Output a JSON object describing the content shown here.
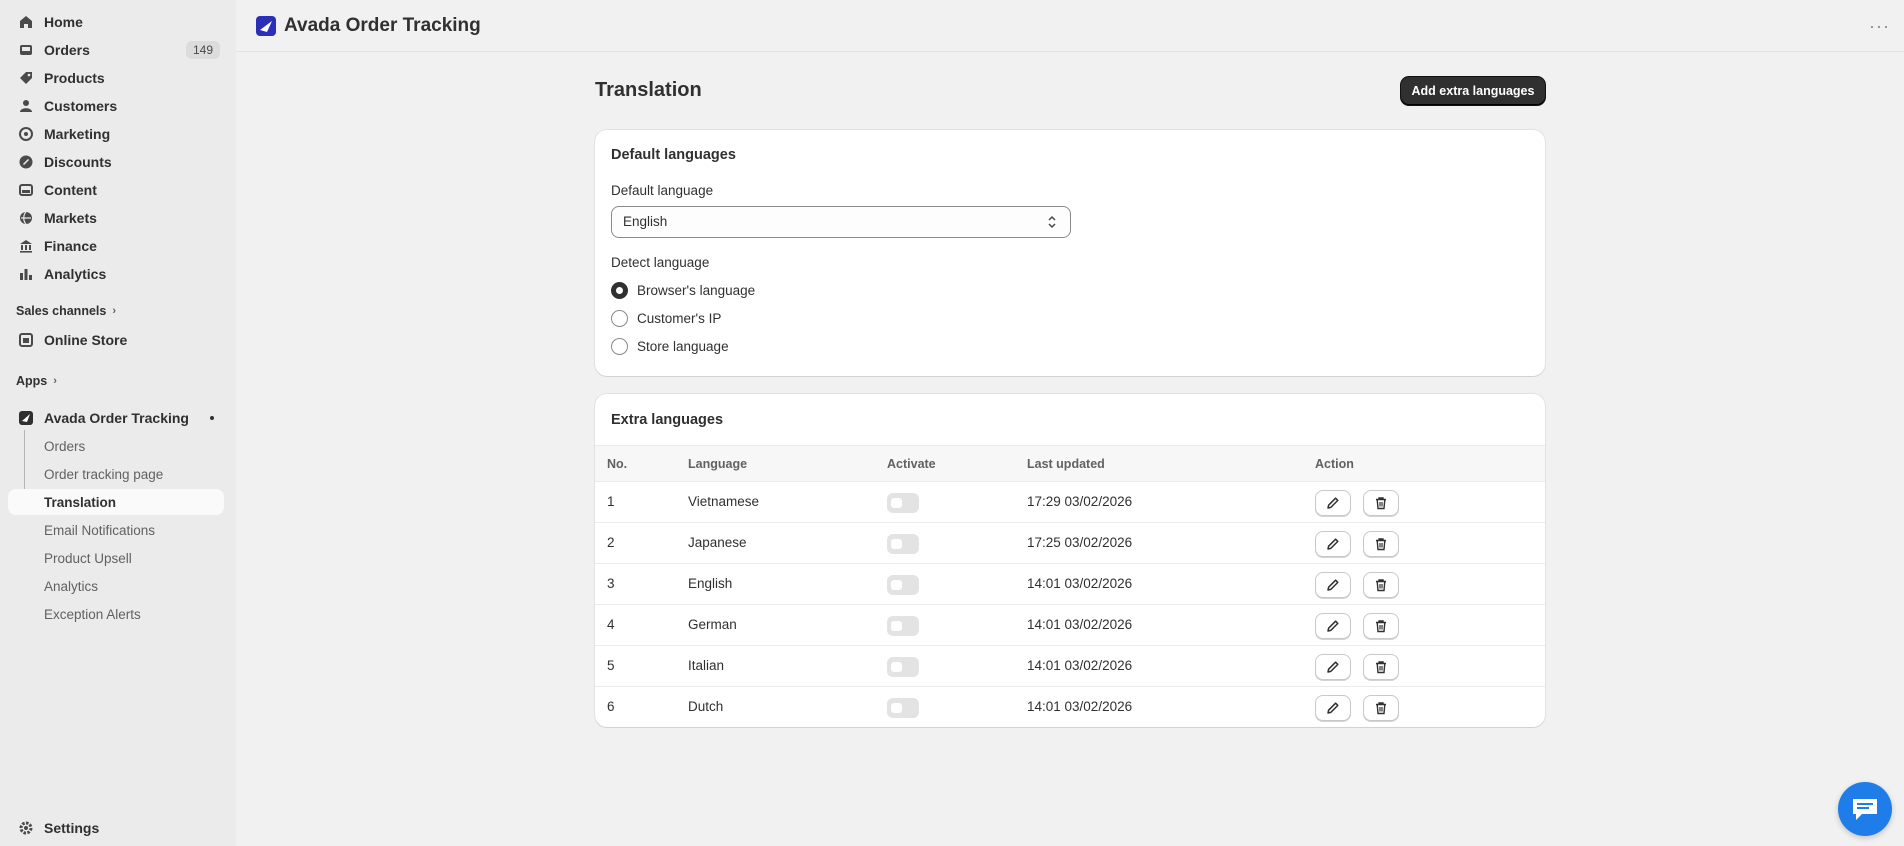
{
  "sidebar": {
    "main_items": [
      {
        "label": "Home",
        "icon": "home-icon"
      },
      {
        "label": "Orders",
        "icon": "inbox-icon",
        "count": "149"
      },
      {
        "label": "Products",
        "icon": "tag-icon"
      },
      {
        "label": "Customers",
        "icon": "person-icon"
      },
      {
        "label": "Marketing",
        "icon": "target-icon"
      },
      {
        "label": "Discounts",
        "icon": "discount-icon"
      },
      {
        "label": "Content",
        "icon": "content-icon"
      },
      {
        "label": "Markets",
        "icon": "globe-icon"
      },
      {
        "label": "Finance",
        "icon": "bank-icon"
      },
      {
        "label": "Analytics",
        "icon": "bar-chart-icon"
      }
    ],
    "sales_channels_label": "Sales channels",
    "online_store_label": "Online Store",
    "apps_label": "Apps",
    "app_name": "Avada Order Tracking",
    "app_sub_items": [
      "Orders",
      "Order tracking page",
      "Translation",
      "Email Notifications",
      "Product Upsell",
      "Analytics",
      "Exception Alerts"
    ],
    "settings_label": "Settings"
  },
  "topbar": {
    "app_title": "Avada Order Tracking",
    "more_label": "···"
  },
  "page": {
    "title": "Translation",
    "add_button_label": "Add extra languages"
  },
  "default_card": {
    "title": "Default languages",
    "default_language_label": "Default language",
    "default_language_value": "English",
    "detect_language_label": "Detect language",
    "detect_options": [
      {
        "label": "Browser's language",
        "selected": true
      },
      {
        "label": "Customer's IP",
        "selected": false
      },
      {
        "label": "Store language",
        "selected": false
      }
    ]
  },
  "extra_card": {
    "title": "Extra languages",
    "columns": [
      "No.",
      "Language",
      "Activate",
      "Last updated",
      "Action"
    ],
    "rows": [
      {
        "no": "1",
        "language": "Vietnamese",
        "active": false,
        "updated": "17:29 03/02/2026"
      },
      {
        "no": "2",
        "language": "Japanese",
        "active": false,
        "updated": "17:25 03/02/2026"
      },
      {
        "no": "3",
        "language": "English",
        "active": false,
        "updated": "14:01 03/02/2026"
      },
      {
        "no": "4",
        "language": "German",
        "active": false,
        "updated": "14:01 03/02/2026"
      },
      {
        "no": "5",
        "language": "Italian",
        "active": false,
        "updated": "14:01 03/02/2026"
      },
      {
        "no": "6",
        "language": "Dutch",
        "active": false,
        "updated": "14:01 03/02/2026"
      }
    ]
  },
  "colors": {
    "primary_button": "#303030",
    "chat_bubble": "#1e7de8",
    "app_logo": "#2b2fb7"
  }
}
